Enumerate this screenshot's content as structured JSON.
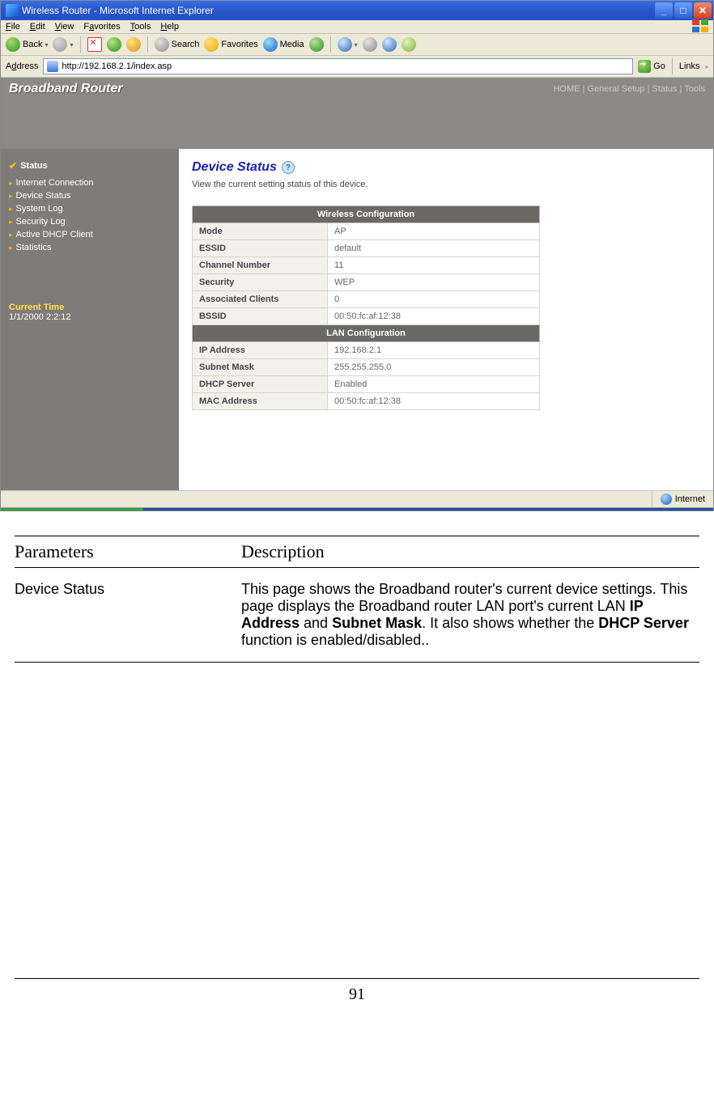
{
  "browser": {
    "title": "Wireless Router - Microsoft Internet Explorer",
    "menu": {
      "file": "File",
      "edit": "Edit",
      "view": "View",
      "favorites": "Favorites",
      "tools": "Tools",
      "help": "Help"
    },
    "toolbar": {
      "back": "Back",
      "search": "Search",
      "favorites": "Favorites",
      "media": "Media"
    },
    "address_label": "Address",
    "url": "http://192.168.2.1/index.asp",
    "go": "Go",
    "links": "Links",
    "zone": "Internet"
  },
  "router": {
    "brand": "Broadband Router",
    "navlinks": "HOME | General Setup | Status | Tools",
    "sidebar": {
      "title": "Status",
      "items": [
        "Internet Connection",
        "Device Status",
        "System Log",
        "Security Log",
        "Active DHCP Client",
        "Statistics"
      ],
      "curtime_label": "Current Time",
      "curtime_value": "1/1/2000 2:2:12"
    },
    "page": {
      "title": "Device Status",
      "subtitle": "View the current setting status of this device.",
      "wlan_header": "Wireless Configuration",
      "wlan": [
        {
          "k": "Mode",
          "v": "AP"
        },
        {
          "k": "ESSID",
          "v": "default"
        },
        {
          "k": "Channel Number",
          "v": "11"
        },
        {
          "k": "Security",
          "v": " WEP"
        },
        {
          "k": "Associated Clients",
          "v": "0"
        },
        {
          "k": "BSSID",
          "v": "00:50:fc:af:12:38"
        }
      ],
      "lan_header": "LAN Configuration",
      "lan": [
        {
          "k": "IP Address",
          "v": "192.168.2.1"
        },
        {
          "k": "Subnet Mask",
          "v": "255.255.255.0"
        },
        {
          "k": "DHCP Server",
          "v": "Enabled"
        },
        {
          "k": "MAC Address",
          "v": "00:50:fc:af:12:38"
        }
      ]
    }
  },
  "doc": {
    "col1": "Parameters",
    "col2": "Description",
    "param": "Device Status",
    "desc_pre": "This page shows the Broadband router's current device settings. This page displays the Broadband router LAN port's current LAN ",
    "b1": "IP Address",
    "mid1": " and ",
    "b2": "Subnet Mask",
    "mid2": ". It also shows whether the ",
    "b3": "DHCP Server",
    "tail": " function is enabled/disabled..",
    "pagenum": "91"
  }
}
